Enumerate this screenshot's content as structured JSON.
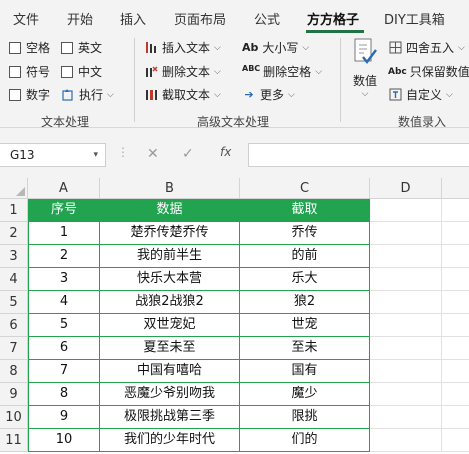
{
  "ribbon_tabs": [
    "文件",
    "开始",
    "插入",
    "页面布局",
    "公式",
    "方方格子",
    "DIY工具箱"
  ],
  "active_tab": "方方格子",
  "text_processing": {
    "checkboxes": [
      "空格",
      "英文",
      "符号",
      "中文",
      "数字"
    ],
    "execute_label": "执行",
    "group_label": "文本处理"
  },
  "advanced_text": {
    "insert_text": "插入文本",
    "delete_text": "删除文本",
    "extract_text": "截取文本",
    "case": "大小写",
    "delete_spaces": "删除空格",
    "more": "更多",
    "group_label": "高级文本处理"
  },
  "number_entry": {
    "value_label": "数值",
    "round_label": "四舍五入",
    "keep_values_label": "只保留数值",
    "custom_label": "自定义",
    "group_label": "数值录入"
  },
  "icon_glyphs": {
    "case": "Ab",
    "delete_spaces": "ABC",
    "keep_values": "Abc"
  },
  "name_box": "G13",
  "formula_value": "",
  "columns": [
    "A",
    "B",
    "C",
    "D"
  ],
  "rows": [
    "1",
    "2",
    "3",
    "4",
    "5",
    "6",
    "7",
    "8",
    "9",
    "10",
    "11"
  ],
  "table": {
    "headers": [
      "序号",
      "数据",
      "截取"
    ],
    "rows": [
      [
        "1",
        "楚乔传楚乔传",
        "乔传"
      ],
      [
        "2",
        "我的前半生",
        "的前"
      ],
      [
        "3",
        "快乐大本营",
        "乐大"
      ],
      [
        "4",
        "战狼2战狼2",
        "狼2"
      ],
      [
        "5",
        "双世宠妃",
        "世宠"
      ],
      [
        "6",
        "夏至未至",
        "至未"
      ],
      [
        "7",
        "中国有嘻哈",
        "国有"
      ],
      [
        "8",
        "恶魔少爷别吻我",
        "魔少"
      ],
      [
        "9",
        "极限挑战第三季",
        "限挑"
      ],
      [
        "10",
        "我们的少年时代",
        "们的"
      ]
    ]
  },
  "colors": {
    "accent_green": "#217346",
    "table_header_bg": "#21a350",
    "table_border": "#21a350"
  }
}
